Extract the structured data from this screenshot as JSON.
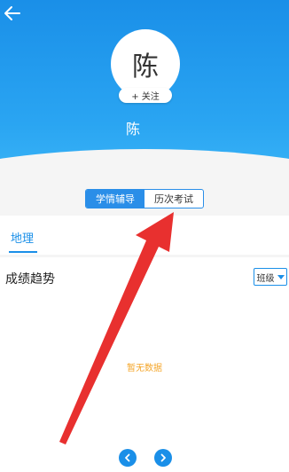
{
  "header": {
    "back_icon": "back-arrow-icon",
    "avatar_char": "陈",
    "follow_label": "+ 关注",
    "user_name": "陈"
  },
  "tabs": [
    {
      "label": "学情辅导",
      "active": true
    },
    {
      "label": "历次考试",
      "active": false
    }
  ],
  "subject": {
    "label": "地理"
  },
  "trend": {
    "title": "成绩趋势",
    "select_label": "班级",
    "empty_text": "暂无数据"
  },
  "pager": {
    "prev_icon": "chevron-left-icon",
    "next_icon": "chevron-right-icon"
  },
  "colors": {
    "accent": "#1a8fe8",
    "empty": "#f4a62a",
    "annotation_arrow": "#e8302f"
  }
}
